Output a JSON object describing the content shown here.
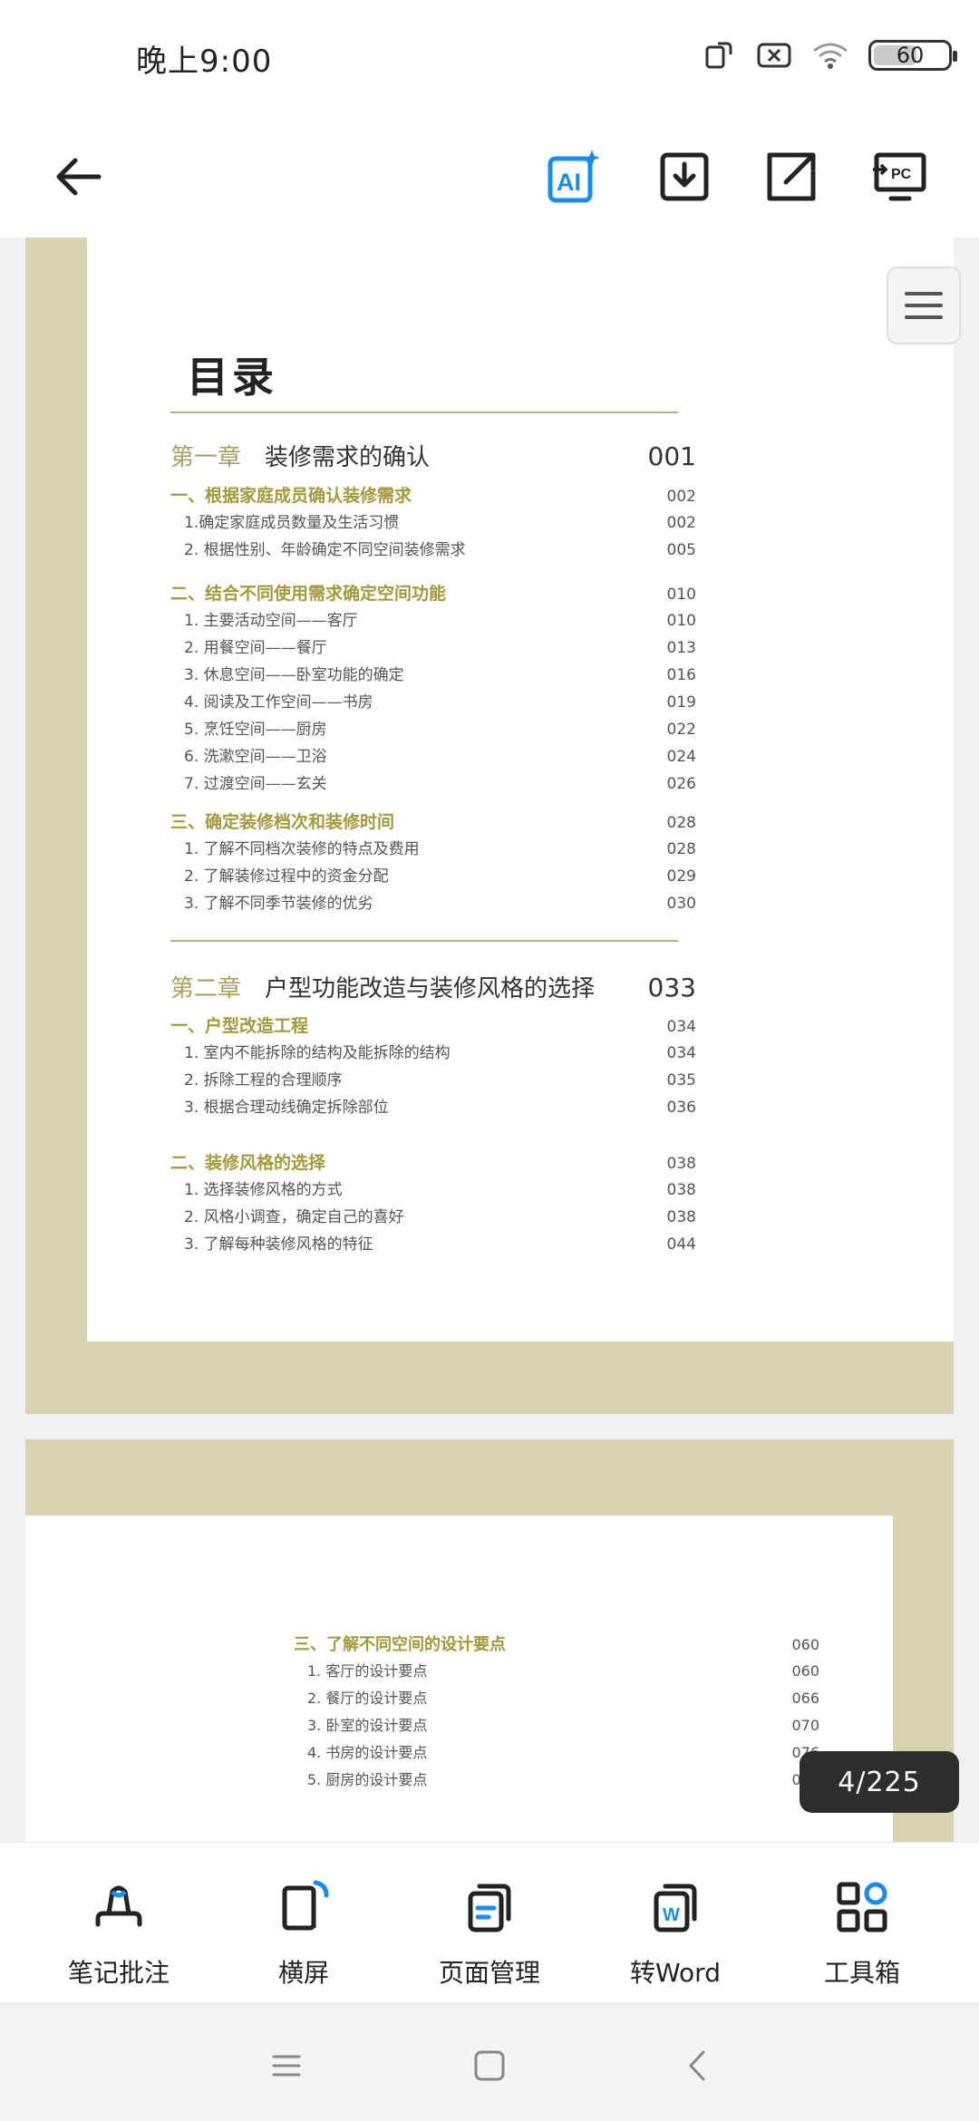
{
  "status": {
    "time": "晚上9:00",
    "battery": "60"
  },
  "toolbar": {
    "back_icon": "arrow-left-icon",
    "ai_label": "AI",
    "accent": "#1a8cf0"
  },
  "toc": {
    "title": "目录",
    "chapter1": {
      "label": "第一章",
      "title": "装修需求的确认",
      "page": "001"
    },
    "sections1": [
      {
        "title": "一、根据家庭成员确认装修需求",
        "page": "002",
        "items": [
          {
            "t": "1.确定家庭成员数量及生活习惯",
            "p": "002"
          },
          {
            "t": "2. 根据性别、年龄确定不同空间装修需求",
            "p": "005"
          }
        ]
      },
      {
        "title": "二、结合不同使用需求确定空间功能",
        "page": "010",
        "items": [
          {
            "t": "1. 主要活动空间——客厅",
            "p": "010"
          },
          {
            "t": "2. 用餐空间——餐厅",
            "p": "013"
          },
          {
            "t": "3. 休息空间——卧室功能的确定",
            "p": "016"
          },
          {
            "t": "4. 阅读及工作空间——书房",
            "p": "019"
          },
          {
            "t": "5. 烹饪空间——厨房",
            "p": "022"
          },
          {
            "t": "6. 洗漱空间——卫浴",
            "p": "024"
          },
          {
            "t": "7. 过渡空间——玄关",
            "p": "026"
          }
        ]
      },
      {
        "title": "三、确定装修档次和装修时间",
        "page": "028",
        "items": [
          {
            "t": "1. 了解不同档次装修的特点及费用",
            "p": "028"
          },
          {
            "t": "2. 了解装修过程中的资金分配",
            "p": "029"
          },
          {
            "t": "3. 了解不同季节装修的优劣",
            "p": "030"
          }
        ]
      }
    ],
    "chapter2": {
      "label": "第二章",
      "title": "户型功能改造与装修风格的选择",
      "page": "033"
    },
    "sections2": [
      {
        "title": "一、户型改造工程",
        "page": "034",
        "items": [
          {
            "t": "1. 室内不能拆除的结构及能拆除的结构",
            "p": "034"
          },
          {
            "t": "2. 拆除工程的合理顺序",
            "p": "035"
          },
          {
            "t": "3. 根据合理动线确定拆除部位",
            "p": "036"
          }
        ]
      },
      {
        "title": "二、装修风格的选择",
        "page": "038",
        "items": [
          {
            "t": "1. 选择装修风格的方式",
            "p": "038"
          },
          {
            "t": "2. 风格小调查，确定自己的喜好",
            "p": "038"
          },
          {
            "t": "3. 了解每种装修风格的特征",
            "p": "044"
          }
        ]
      }
    ]
  },
  "page2": {
    "section": {
      "title": "三、了解不同空间的设计要点",
      "page": "060"
    },
    "items": [
      {
        "t": "1. 客厅的设计要点",
        "p": "060"
      },
      {
        "t": "2. 餐厅的设计要点",
        "p": "066"
      },
      {
        "t": "3. 卧室的设计要点",
        "p": "070"
      },
      {
        "t": "4. 书房的设计要点",
        "p": "076"
      },
      {
        "t": "5. 厨房的设计要点",
        "p": "080"
      }
    ]
  },
  "counter": "4/225",
  "bottom": {
    "items": [
      {
        "label": "笔记批注",
        "icon": "pen-note-icon"
      },
      {
        "label": "横屏",
        "icon": "rotate-screen-icon"
      },
      {
        "label": "页面管理",
        "icon": "page-manage-icon"
      },
      {
        "label": "转Word",
        "icon": "word-convert-icon"
      },
      {
        "label": "工具箱",
        "icon": "toolbox-icon"
      }
    ]
  }
}
